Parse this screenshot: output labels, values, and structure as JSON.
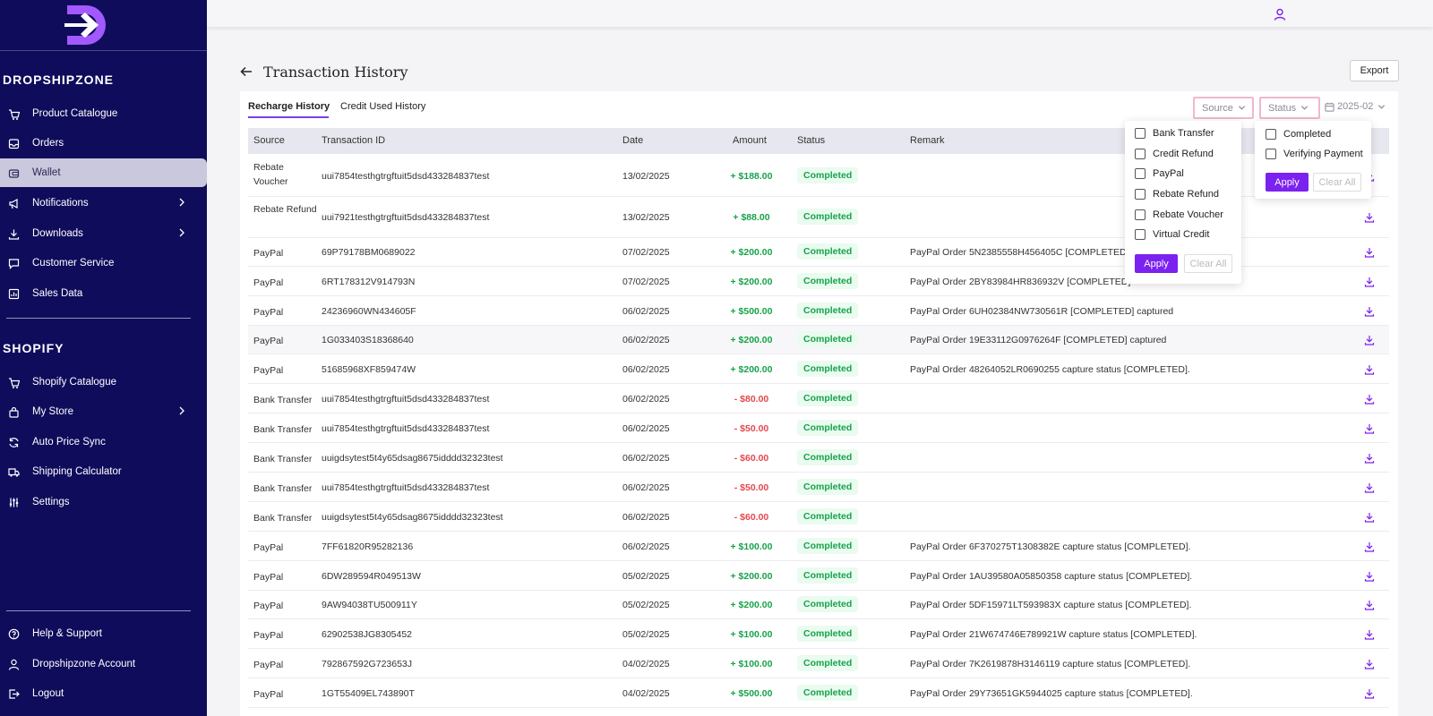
{
  "brand": {
    "name": "DROPSHIPZONE",
    "accent": "#7b22f0",
    "sidebar_bg": "#0f0c5c"
  },
  "sidebar": {
    "section1_title": "DROPSHIPZONE",
    "section1_items": [
      {
        "label": "Product Catalogue",
        "icon": "cart-icon",
        "active": false,
        "chevron": false
      },
      {
        "label": "Orders",
        "icon": "inbox-icon",
        "active": false,
        "chevron": false
      },
      {
        "label": "Wallet",
        "icon": "wallet-icon",
        "active": true,
        "chevron": false
      },
      {
        "label": "Notifications",
        "icon": "megaphone-icon",
        "active": false,
        "chevron": true
      },
      {
        "label": "Downloads",
        "icon": "download-icon",
        "active": false,
        "chevron": true
      },
      {
        "label": "Customer Service",
        "icon": "chat-icon",
        "active": false,
        "chevron": false
      },
      {
        "label": "Sales Data",
        "icon": "chart-icon",
        "active": false,
        "chevron": false
      }
    ],
    "section2_title": "SHOPIFY",
    "section2_items": [
      {
        "label": "Shopify Catalogue",
        "icon": "cart-icon",
        "active": false,
        "chevron": false
      },
      {
        "label": "My Store",
        "icon": "bag-icon",
        "active": false,
        "chevron": true
      },
      {
        "label": "Auto Price Sync",
        "icon": "sync-icon",
        "active": false,
        "chevron": false
      },
      {
        "label": "Shipping Calculator",
        "icon": "truck-icon",
        "active": false,
        "chevron": false
      },
      {
        "label": "Settings",
        "icon": "sliders-icon",
        "active": false,
        "chevron": false
      }
    ],
    "bottom_items": [
      {
        "label": "Help & Support",
        "icon": "help-icon"
      },
      {
        "label": "Dropshipzone Account",
        "icon": "user-icon"
      },
      {
        "label": "Logout",
        "icon": "logout-icon"
      }
    ]
  },
  "header": {
    "title": "Transaction History",
    "export_label": "Export"
  },
  "tabs": [
    {
      "label": "Recharge History",
      "active": true
    },
    {
      "label": "Credit Used History",
      "active": false
    }
  ],
  "filters": {
    "source_label": "Source",
    "status_label": "Status",
    "date_label": "2025-02"
  },
  "columns": [
    "Source",
    "Transaction ID",
    "Date",
    "Amount",
    "Status",
    "Remark"
  ],
  "rows": [
    {
      "source": "Rebate Voucher",
      "id": "uui7854testhgtrgftuit5dsd433284837test",
      "date": "13/02/2025",
      "amount": "+ $188.00",
      "sign": "pos",
      "status": "Completed",
      "remark": ""
    },
    {
      "source": "Rebate Refund",
      "id": "uui7921testhgtrgftuit5dsd433284837test",
      "date": "13/02/2025",
      "amount": "+ $88.00",
      "sign": "pos",
      "status": "Completed",
      "remark": ""
    },
    {
      "source": "PayPal",
      "id": "69P79178BM0689022",
      "date": "07/02/2025",
      "amount": "+ $200.00",
      "sign": "pos",
      "status": "Completed",
      "remark": "PayPal Order 5N2385558H456405C [COMPLETED]"
    },
    {
      "source": "PayPal",
      "id": "6RT178312V914793N",
      "date": "07/02/2025",
      "amount": "+ $200.00",
      "sign": "pos",
      "status": "Completed",
      "remark": "PayPal Order 2BY83984HR836932V [COMPLETED]"
    },
    {
      "source": "PayPal",
      "id": "24236960WN434605F",
      "date": "06/02/2025",
      "amount": "+ $500.00",
      "sign": "pos",
      "status": "Completed",
      "remark": "PayPal Order 6UH02384NW730561R [COMPLETED] captured"
    },
    {
      "source": "PayPal",
      "id": "1G033403S18368640",
      "date": "06/02/2025",
      "amount": "+ $200.00",
      "sign": "pos",
      "status": "Completed",
      "remark": "PayPal Order 19E33112G0976264F [COMPLETED] captured"
    },
    {
      "source": "PayPal",
      "id": "51685968XF859474W",
      "date": "06/02/2025",
      "amount": "+ $200.00",
      "sign": "pos",
      "status": "Completed",
      "remark": "PayPal Order 48264052LR0690255 capture status [COMPLETED]."
    },
    {
      "source": "Bank Transfer",
      "id": "uui7854testhgtrgftuit5dsd433284837test",
      "date": "06/02/2025",
      "amount": "- $80.00",
      "sign": "neg",
      "status": "Completed",
      "remark": ""
    },
    {
      "source": "Bank Transfer",
      "id": "uui7854testhgtrgftuit5dsd433284837test",
      "date": "06/02/2025",
      "amount": "- $50.00",
      "sign": "neg",
      "status": "Completed",
      "remark": ""
    },
    {
      "source": "Bank Transfer",
      "id": "uuigdsytest5t4y65dsag8675idddd32323test",
      "date": "06/02/2025",
      "amount": "- $60.00",
      "sign": "neg",
      "status": "Completed",
      "remark": ""
    },
    {
      "source": "Bank Transfer",
      "id": "uui7854testhgtrgftuit5dsd433284837test",
      "date": "06/02/2025",
      "amount": "- $50.00",
      "sign": "neg",
      "status": "Completed",
      "remark": ""
    },
    {
      "source": "Bank Transfer",
      "id": "uuigdsytest5t4y65dsag8675idddd32323test",
      "date": "06/02/2025",
      "amount": "- $60.00",
      "sign": "neg",
      "status": "Completed",
      "remark": ""
    },
    {
      "source": "PayPal",
      "id": "7FF61820R95282136",
      "date": "06/02/2025",
      "amount": "+ $100.00",
      "sign": "pos",
      "status": "Completed",
      "remark": "PayPal Order 6F370275T1308382E capture status [COMPLETED]."
    },
    {
      "source": "PayPal",
      "id": "6DW289594R049513W",
      "date": "05/02/2025",
      "amount": "+ $200.00",
      "sign": "pos",
      "status": "Completed",
      "remark": "PayPal Order 1AU39580A05850358 capture status [COMPLETED]."
    },
    {
      "source": "PayPal",
      "id": "9AW94038TU500911Y",
      "date": "05/02/2025",
      "amount": "+ $200.00",
      "sign": "pos",
      "status": "Completed",
      "remark": "PayPal Order 5DF15971LT593983X capture status [COMPLETED]."
    },
    {
      "source": "PayPal",
      "id": "62902538JG8305452",
      "date": "05/02/2025",
      "amount": "+ $100.00",
      "sign": "pos",
      "status": "Completed",
      "remark": "PayPal Order 21W674746E789921W capture status [COMPLETED]."
    },
    {
      "source": "PayPal",
      "id": "792867592G723653J",
      "date": "04/02/2025",
      "amount": "+ $100.00",
      "sign": "pos",
      "status": "Completed",
      "remark": "PayPal Order 7K2619878H3146119 capture status [COMPLETED]."
    },
    {
      "source": "PayPal",
      "id": "1GT55409EL743890T",
      "date": "04/02/2025",
      "amount": "+ $500.00",
      "sign": "pos",
      "status": "Completed",
      "remark": "PayPal Order 29Y73651GK5944025 capture status [COMPLETED]."
    }
  ],
  "source_dropdown": {
    "options": [
      "Bank Transfer",
      "Credit Refund",
      "PayPal",
      "Rebate Refund",
      "Rebate Voucher",
      "Virtual Credit"
    ],
    "apply_label": "Apply",
    "clear_label": "Clear All"
  },
  "status_dropdown": {
    "options": [
      "Completed",
      "Verifying Payment"
    ],
    "apply_label": "Apply",
    "clear_label": "Clear All"
  }
}
